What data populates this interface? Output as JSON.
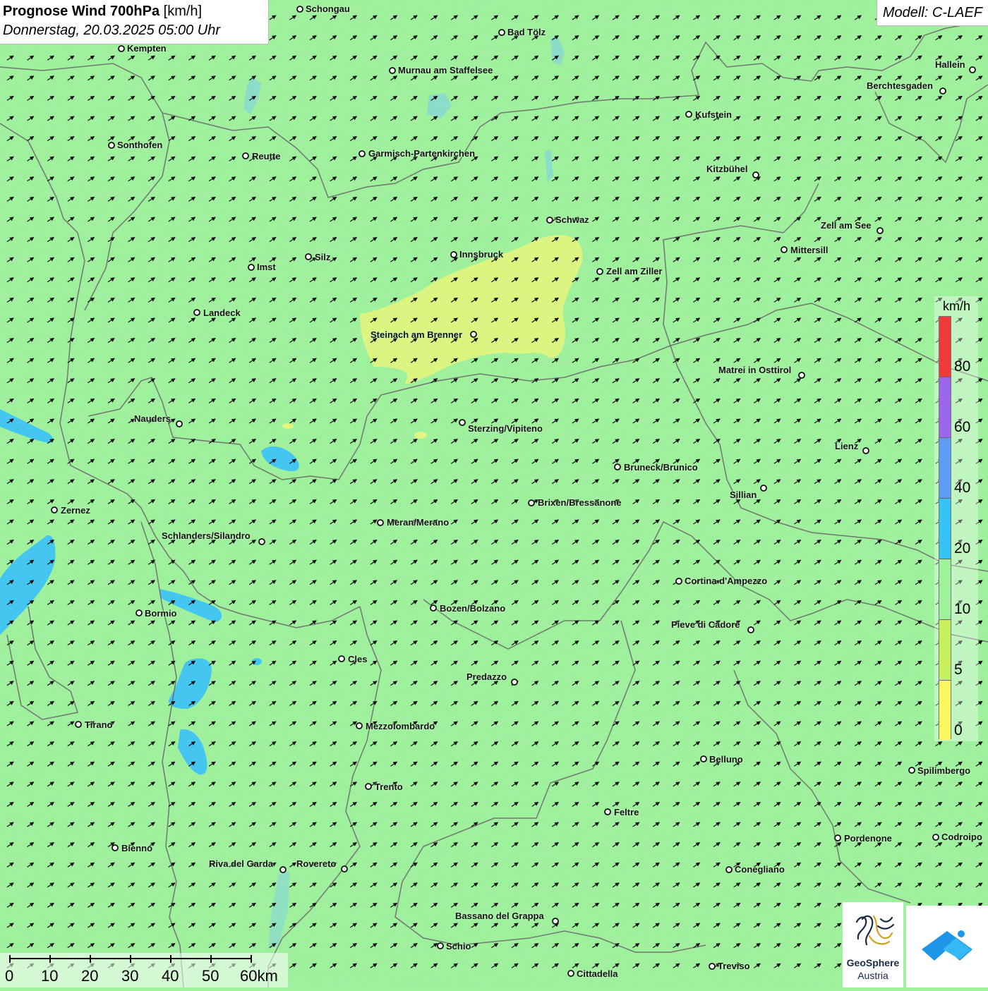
{
  "header": {
    "title_bold": "Prognose Wind 700hPa",
    "title_unit": "[km/h]",
    "datetime": "Donnerstag, 20.03.2025 05:00 Uhr"
  },
  "model_label": "Modell: C-LAEF",
  "cities": [
    {
      "name": "Schongau"
    },
    {
      "name": "Bad Tölz"
    },
    {
      "name": "Kempten"
    },
    {
      "name": "Murnau am Staffelsee"
    },
    {
      "name": "Hallein"
    },
    {
      "name": "Berchtesgaden"
    },
    {
      "name": "Kufstein"
    },
    {
      "name": "Sonthofen"
    },
    {
      "name": "Reutte"
    },
    {
      "name": "Garmisch-Partenkirchen"
    },
    {
      "name": "Kitzbühel"
    },
    {
      "name": "Schwaz"
    },
    {
      "name": "Zell am See"
    },
    {
      "name": "Mittersill"
    },
    {
      "name": "Innsbruck"
    },
    {
      "name": "Silz"
    },
    {
      "name": "Imst"
    },
    {
      "name": "Zell am Ziller"
    },
    {
      "name": "Landeck"
    },
    {
      "name": "Steinach am Brenner"
    },
    {
      "name": "Matrei in Osttirol"
    },
    {
      "name": "Nauders"
    },
    {
      "name": "Sterzing/Vipiteno"
    },
    {
      "name": "Lienz"
    },
    {
      "name": "Bruneck/Brunico"
    },
    {
      "name": "Sillian"
    },
    {
      "name": "Zernez"
    },
    {
      "name": "Brixen/Bressanone"
    },
    {
      "name": "Meran/Merano"
    },
    {
      "name": "Schlanders/Silandro"
    },
    {
      "name": "Cortina d'Ampezzo"
    },
    {
      "name": "Bormio"
    },
    {
      "name": "Bozen/Bolzano"
    },
    {
      "name": "Pieve di Cadore"
    },
    {
      "name": "Cles"
    },
    {
      "name": "Predazzo"
    },
    {
      "name": "Tirano"
    },
    {
      "name": "Mezzolombardo"
    },
    {
      "name": "Belluno"
    },
    {
      "name": "Spilimbergo"
    },
    {
      "name": "Trento"
    },
    {
      "name": "Feltre"
    },
    {
      "name": "Bienno"
    },
    {
      "name": "Pordenone"
    },
    {
      "name": "Codroipo"
    },
    {
      "name": "Riva del Garda"
    },
    {
      "name": "Rovereto"
    },
    {
      "name": "Conegliano"
    },
    {
      "name": "Bassano del Grappa"
    },
    {
      "name": "Schio"
    },
    {
      "name": "Treviso"
    },
    {
      "name": "Cittadella"
    }
  ],
  "legend": {
    "unit": "km/h",
    "labels": [
      "80",
      "60",
      "40",
      "20",
      "10",
      "5",
      "0"
    ],
    "colors": [
      "#f03a38",
      "#9a66ec",
      "#5c9cf2",
      "#35c4f5",
      "#9ef29c",
      "#c6f05c",
      "#fbf75c"
    ]
  },
  "scale_bar": {
    "labels": [
      "0",
      "10",
      "20",
      "30",
      "40",
      "50",
      "60km"
    ]
  },
  "logo": {
    "line1": "GeoSphere",
    "line2": "Austria"
  },
  "colors": {
    "background_wind_band": "#9ef29c",
    "low_wind_band": "#e0f57e",
    "high_wind_band": "#45c6f0",
    "border_lines": "#6b6b6b"
  }
}
